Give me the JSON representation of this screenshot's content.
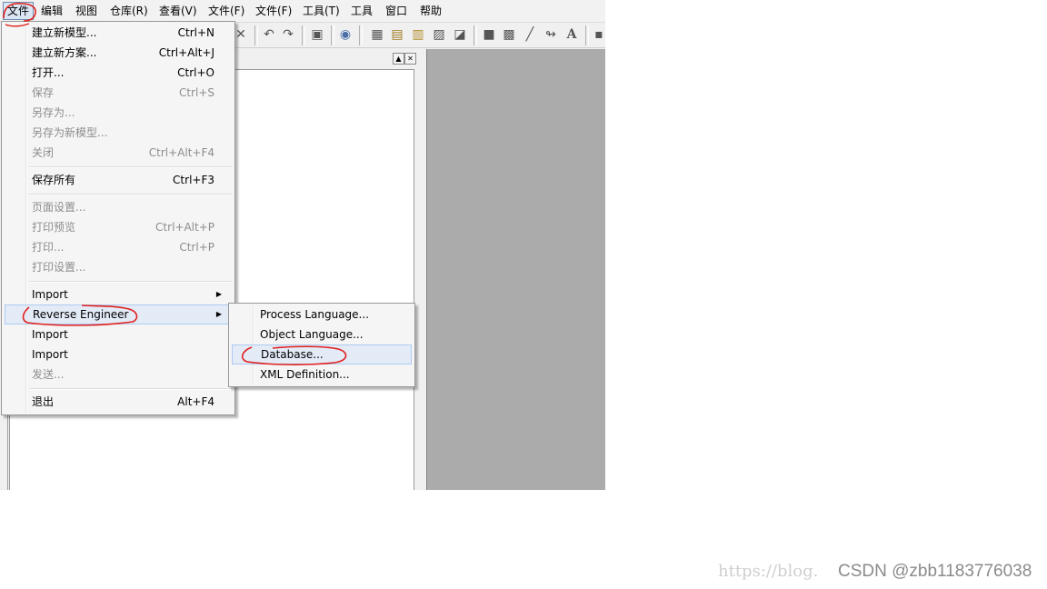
{
  "menubar": {
    "items": [
      {
        "label": "文件"
      },
      {
        "label": "编辑"
      },
      {
        "label": "视图"
      },
      {
        "label": "仓库(R)"
      },
      {
        "label": "查看(V)"
      },
      {
        "label": "文件(F)"
      },
      {
        "label": "文件(F)"
      },
      {
        "label": "工具(T)"
      },
      {
        "label": "工具"
      },
      {
        "label": "窗口"
      },
      {
        "label": "帮助"
      }
    ]
  },
  "toolbar": {
    "icons": [
      "close-icon",
      "undo-icon",
      "redo-icon",
      "print-icon",
      "globe-icon",
      "new-package-icon",
      "palette-icon",
      "new-table-icon",
      "image-icon",
      "note-icon",
      "rectangle-icon",
      "frame-icon",
      "line-icon",
      "link-icon",
      "text-icon"
    ],
    "text_glyph": "A"
  },
  "file_menu": {
    "items": [
      {
        "label": "建立新模型...",
        "shortcut": "Ctrl+N",
        "enabled": true
      },
      {
        "label": "建立新方案...",
        "shortcut": "Ctrl+Alt+J",
        "enabled": true
      },
      {
        "label": "打开...",
        "shortcut": "Ctrl+O",
        "enabled": true
      },
      {
        "label": "保存",
        "shortcut": "Ctrl+S",
        "enabled": false
      },
      {
        "label": "另存为...",
        "shortcut": "",
        "enabled": false
      },
      {
        "label": "另存为新模型...",
        "shortcut": "",
        "enabled": false
      },
      {
        "label": "关闭",
        "shortcut": "Ctrl+Alt+F4",
        "enabled": false
      },
      {
        "label": "保存所有",
        "shortcut": "Ctrl+F3",
        "enabled": true
      },
      {
        "label": "页面设置...",
        "shortcut": "",
        "enabled": false
      },
      {
        "label": "打印预览",
        "shortcut": "Ctrl+Alt+P",
        "enabled": false
      },
      {
        "label": "打印...",
        "shortcut": "Ctrl+P",
        "enabled": false
      },
      {
        "label": "打印设置...",
        "shortcut": "",
        "enabled": false
      },
      {
        "label": "Import",
        "shortcut": "",
        "enabled": true,
        "submenu": true
      },
      {
        "label": "Reverse Engineer",
        "shortcut": "",
        "enabled": true,
        "submenu": true,
        "highlighted": true
      },
      {
        "label": "Import",
        "shortcut": "",
        "enabled": true
      },
      {
        "label": "Import",
        "shortcut": "",
        "enabled": true
      },
      {
        "label": "发送...",
        "shortcut": "",
        "enabled": false
      },
      {
        "label": "退出",
        "shortcut": "Alt+F4",
        "enabled": true
      }
    ]
  },
  "reverse_engineer_submenu": {
    "items": [
      {
        "label": "Process Language..."
      },
      {
        "label": "Object Language..."
      },
      {
        "label": "Database...",
        "highlighted": true
      },
      {
        "label": "XML Definition..."
      }
    ]
  },
  "pane": {
    "restore_glyph": "▲",
    "close_glyph": "✕"
  },
  "watermark": {
    "url": "https://blog.",
    "csdn": "CSDN @zbb1183776038"
  },
  "colors": {
    "annotation_red": "#e0201e",
    "menu_highlight": "#e3ebf7",
    "workspace_gray": "#ababab"
  }
}
